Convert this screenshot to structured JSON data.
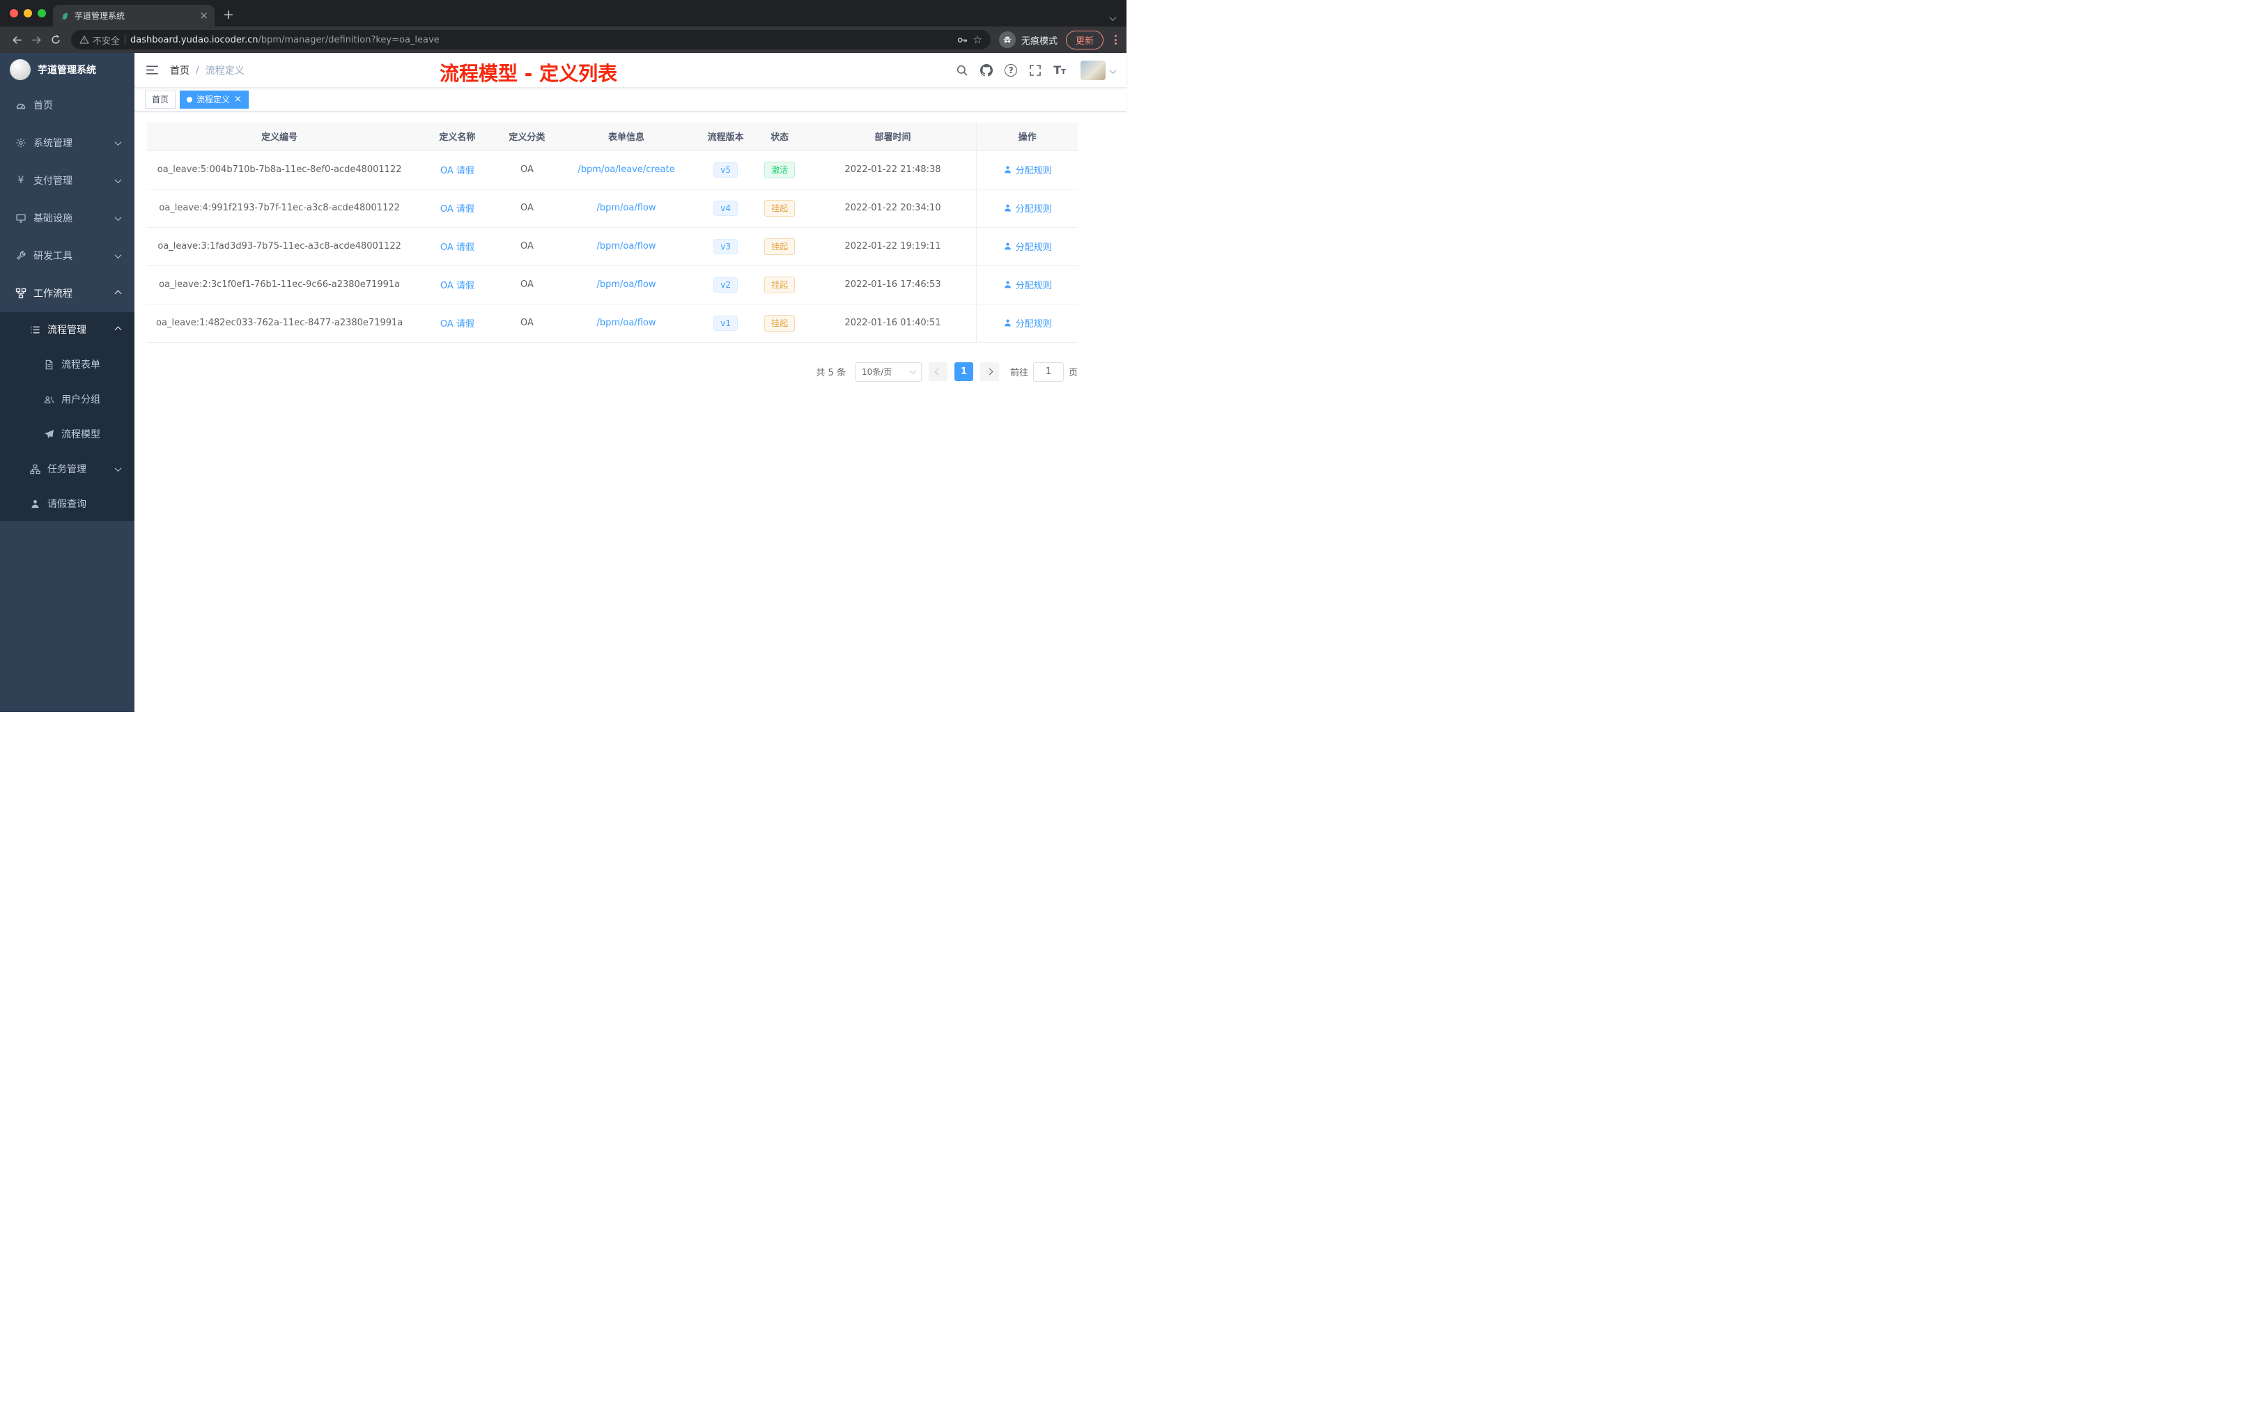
{
  "browser": {
    "tab": {
      "title": "芋道管理系统"
    },
    "address": {
      "security_label": "不安全",
      "domain": "dashboard.yudao.iocoder.cn",
      "path": "/bpm/manager/definition?key=oa_leave"
    },
    "incognito_label": "无痕模式",
    "update_label": "更新"
  },
  "icons": {
    "close": "×",
    "new_tab": "+",
    "yen": "¥",
    "star": "☆",
    "help": "?",
    "font": "T"
  },
  "sidebar": {
    "logo_title": "芋道管理系统",
    "menu": [
      {
        "label": "首页"
      },
      {
        "label": "系统管理"
      },
      {
        "label": "支付管理"
      },
      {
        "label": "基础设施"
      },
      {
        "label": "研发工具"
      },
      {
        "label": "工作流程"
      },
      {
        "label": "流程管理"
      },
      {
        "label": "流程表单"
      },
      {
        "label": "用户分组"
      },
      {
        "label": "流程模型"
      },
      {
        "label": "任务管理"
      },
      {
        "label": "请假查询"
      }
    ]
  },
  "header": {
    "breadcrumb": {
      "home": "首页",
      "separator": "/",
      "current": "流程定义"
    },
    "annotation": "流程模型 - 定义列表"
  },
  "tags": {
    "home": "首页",
    "active": "流程定义"
  },
  "table": {
    "columns": [
      "定义编号",
      "定义名称",
      "定义分类",
      "表单信息",
      "流程版本",
      "状态",
      "部署时间",
      "操作"
    ],
    "rows": [
      {
        "id": "oa_leave:5:004b710b-7b8a-11ec-8ef0-acde48001122",
        "name": "OA 请假",
        "category": "OA",
        "form": "/bpm/oa/leave/create",
        "version": "v5",
        "status": "激活",
        "deployed": "2022-01-22 21:48:38",
        "action": "分配规则"
      },
      {
        "id": "oa_leave:4:991f2193-7b7f-11ec-a3c8-acde48001122",
        "name": "OA 请假",
        "category": "OA",
        "form": "/bpm/oa/flow",
        "version": "v4",
        "status": "挂起",
        "deployed": "2022-01-22 20:34:10",
        "action": "分配规则"
      },
      {
        "id": "oa_leave:3:1fad3d93-7b75-11ec-a3c8-acde48001122",
        "name": "OA 请假",
        "category": "OA",
        "form": "/bpm/oa/flow",
        "version": "v3",
        "status": "挂起",
        "deployed": "2022-01-22 19:19:11",
        "action": "分配规则"
      },
      {
        "id": "oa_leave:2:3c1f0ef1-76b1-11ec-9c66-a2380e71991a",
        "name": "OA 请假",
        "category": "OA",
        "form": "/bpm/oa/flow",
        "version": "v2",
        "status": "挂起",
        "deployed": "2022-01-16 17:46:53",
        "action": "分配规则"
      },
      {
        "id": "oa_leave:1:482ec033-762a-11ec-8477-a2380e71991a",
        "name": "OA 请假",
        "category": "OA",
        "form": "/bpm/oa/flow",
        "version": "v1",
        "status": "挂起",
        "deployed": "2022-01-16 01:40:51",
        "action": "分配规则"
      }
    ]
  },
  "pagination": {
    "total": "共 5 条",
    "page_size": "10条/页",
    "current_page": "1",
    "goto_label": "前往",
    "goto_value": "1",
    "unit_label": "页"
  },
  "colors": {
    "accent": "#409EFF",
    "success_text": "#13ce66",
    "warning_text": "#e6a23c",
    "annotation_red": "#f5270c",
    "sidebar_bg": "#304156",
    "submenu_bg": "#1f2d3d"
  }
}
